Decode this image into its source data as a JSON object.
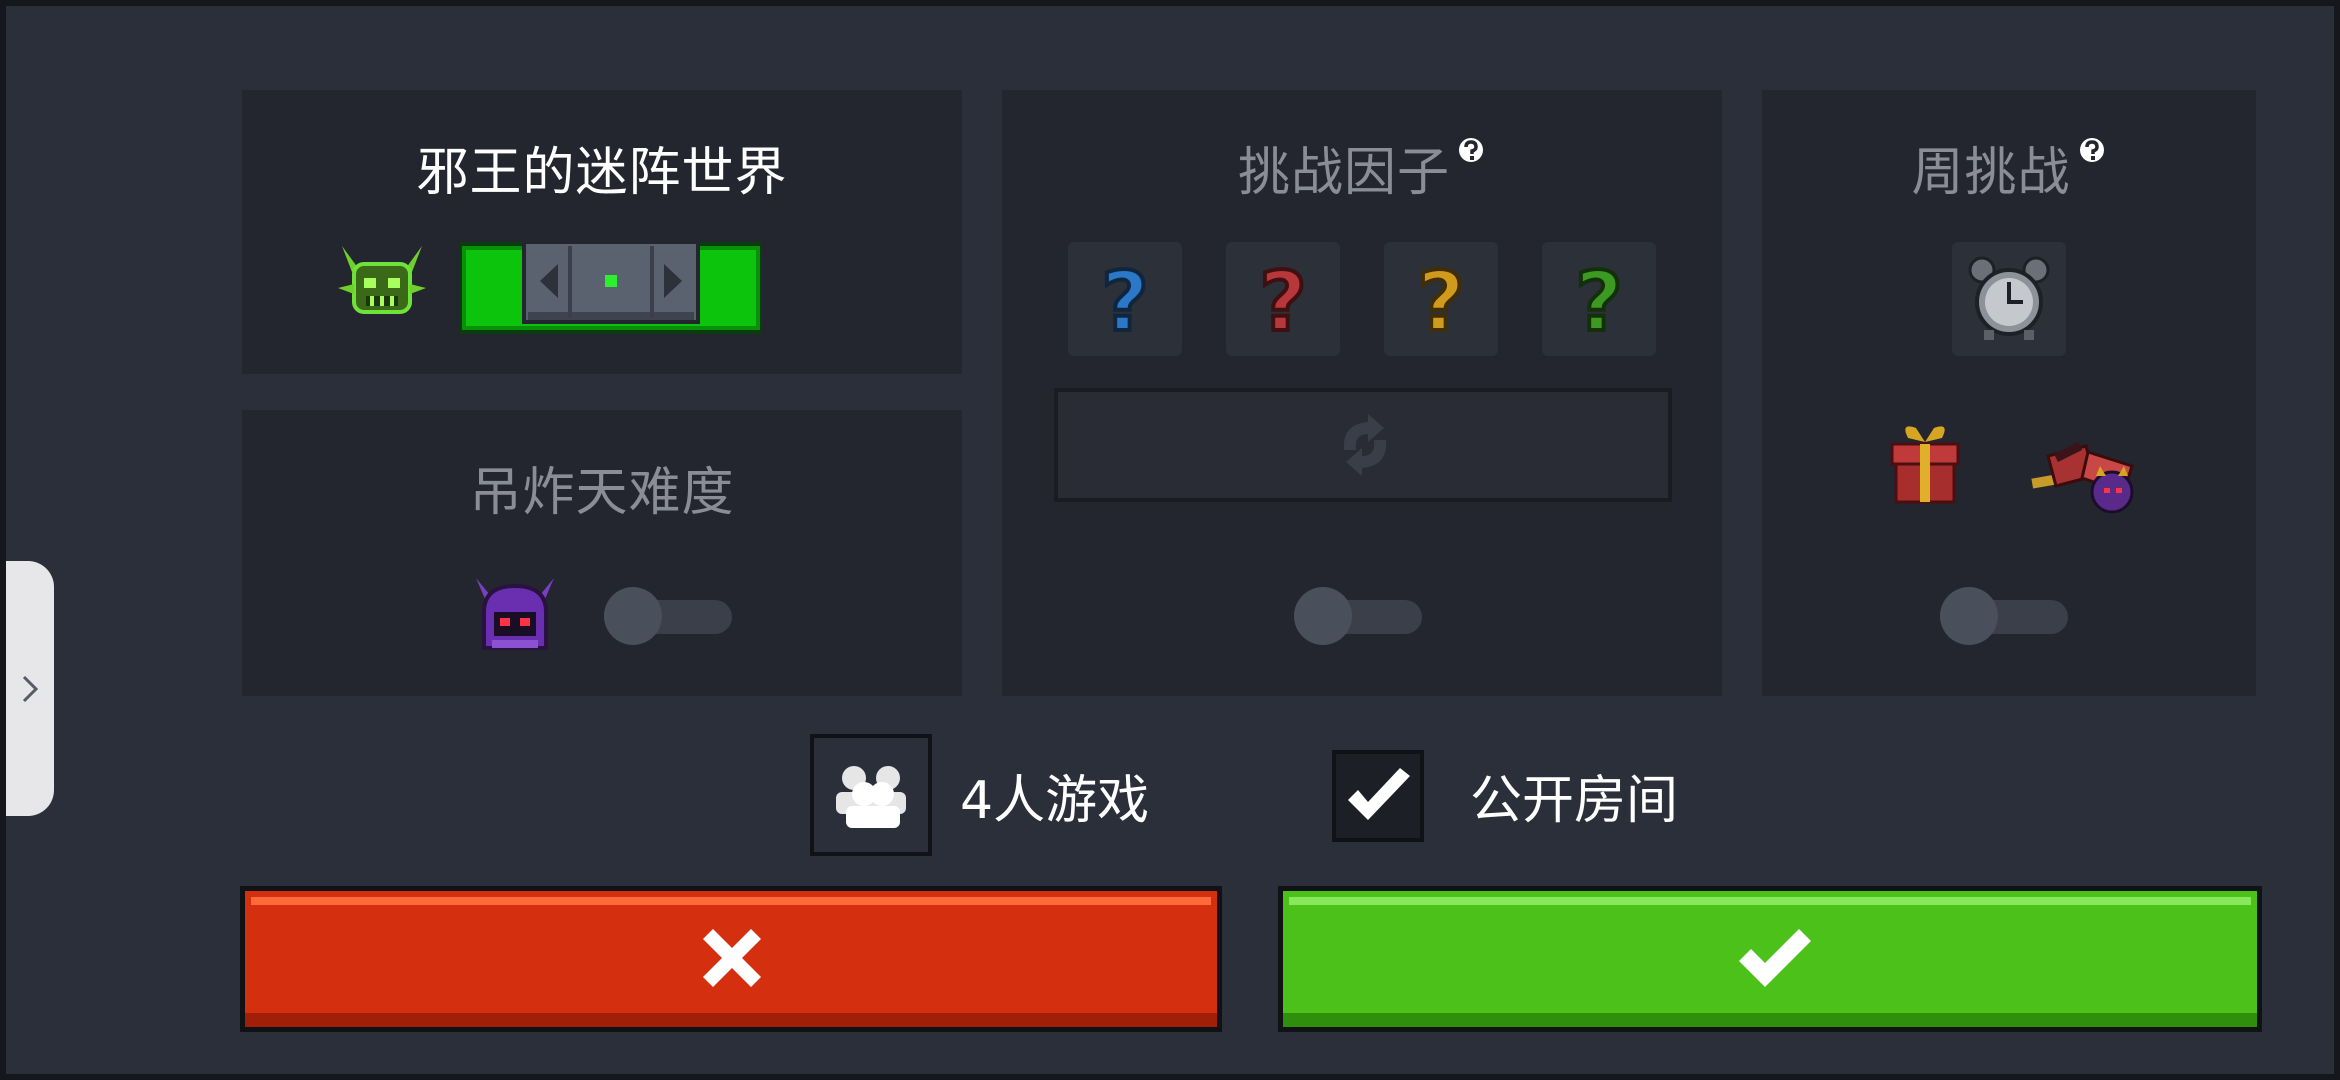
{
  "dungeon": {
    "title": "邪王的迷阵世界"
  },
  "difficulty": {
    "title": "吊炸天难度",
    "enabled": false
  },
  "challenge": {
    "title": "挑战因子",
    "slots": [
      {
        "symbol": "?",
        "color": "#2a78c7"
      },
      {
        "symbol": "?",
        "color": "#b8373a"
      },
      {
        "symbol": "?",
        "color": "#d09a1c"
      },
      {
        "symbol": "?",
        "color": "#3c9a23"
      }
    ],
    "enabled": false
  },
  "weekly": {
    "title": "周挑战",
    "enabled": false
  },
  "options": {
    "players_label": "4人游戏",
    "public_label": "公开房间",
    "public_checked": true
  },
  "colors": {
    "cancel": "#d42f0e",
    "confirm": "#4cc11a"
  }
}
